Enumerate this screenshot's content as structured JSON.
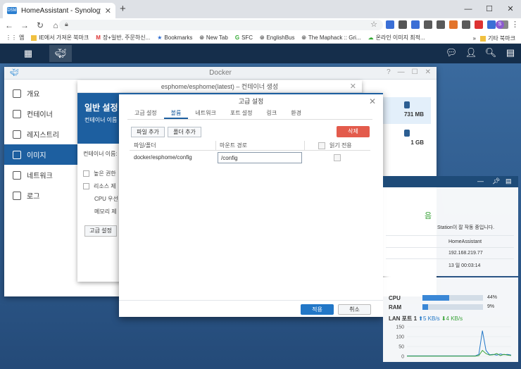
{
  "browser": {
    "tab_title": "HomeAssistant - Synology DiskS",
    "tab_favicon": "DSM",
    "url": "",
    "profile_initial": "S",
    "bookmarks": [
      "앱",
      "IE에서 가져온 북마크",
      "장+일반, 주문하신...",
      "Bookmarks",
      "New Tab",
      "SFC",
      "EnglishBus",
      "The Maphack :: Gri...",
      "온라인 이미지 최적..."
    ],
    "bookmarks_other": "기타 북마크",
    "more": "»"
  },
  "dsm": {
    "taskbar_icons": [
      "grid-icon",
      "docker-icon"
    ],
    "right_icons": [
      "chat-icon",
      "user-icon",
      "search-icon",
      "widget-icon"
    ]
  },
  "docker": {
    "title": "Docker",
    "sidebar": [
      {
        "label": "개요",
        "active": false
      },
      {
        "label": "컨테이너",
        "active": false
      },
      {
        "label": "레지스트리",
        "active": false
      },
      {
        "label": "이미지",
        "active": true
      },
      {
        "label": "네트워크",
        "active": false
      },
      {
        "label": "로그",
        "active": false
      }
    ],
    "image_sizes": [
      "731 MB",
      "1 GB"
    ]
  },
  "create": {
    "title": "esphome/esphome(latest) – 컨테이너 생성",
    "heading": "일반 설정",
    "subheading": "컨테이너 이름",
    "fields": [
      "컨테이너 이름:",
      "높은 권한",
      "리소스 제",
      "CPU 우선",
      "메모리 제"
    ],
    "advanced_button": "고급 설정"
  },
  "advanced": {
    "title": "고급 설정",
    "tabs": [
      "고급 설정",
      "볼륨",
      "네트워크",
      "포트 설정",
      "링크",
      "환경"
    ],
    "active_tab": 1,
    "add_file_button": "파일 추가",
    "add_folder_button": "폴더 추가",
    "delete_button": "삭제",
    "columns": [
      "파일/폴더",
      "마운트 경로",
      "읽기 전용"
    ],
    "rows": [
      {
        "source": "docker/esphome/config",
        "mount_path": "/config",
        "read_only": false
      }
    ],
    "apply_button": "적용",
    "cancel_button": "취소"
  },
  "health_widget": {
    "status": "음",
    "message": "Station이 잘 작동 중입니다.",
    "hostname": "HomeAssistant",
    "ip": "192.168.219.77",
    "uptime": "13 일 00:03:14"
  },
  "resource_widget": {
    "cpu_label": "CPU",
    "cpu_percent": 44,
    "cpu_text": "44%",
    "ram_label": "RAM",
    "ram_percent": 9,
    "ram_text": "9%",
    "lan_label": "LAN 포트 1",
    "lan_up": "5 KB/s",
    "lan_down": "4 KB/s",
    "colors": {
      "up": "#2277c7",
      "down": "#3aa33a"
    }
  },
  "chart_data": {
    "type": "line",
    "title": "",
    "ylim": [
      0,
      150
    ],
    "y_ticks": [
      "150",
      "100",
      "50",
      "0"
    ],
    "x": [
      0,
      1,
      2,
      3,
      4,
      5,
      6,
      7,
      8,
      9,
      10,
      11,
      12,
      13,
      14,
      15,
      16,
      17,
      18,
      19,
      20,
      21,
      22,
      23,
      24,
      25,
      26,
      27,
      28,
      29
    ],
    "series": [
      {
        "values": [
          2,
          2,
          2,
          2,
          2,
          2,
          2,
          2,
          2,
          2,
          2,
          2,
          2,
          2,
          2,
          2,
          2,
          2,
          2,
          2,
          10,
          130,
          30,
          8,
          10,
          6,
          12,
          8,
          10,
          6
        ]
      },
      {
        "values": [
          1,
          1,
          1,
          1,
          1,
          1,
          1,
          1,
          1,
          1,
          1,
          1,
          1,
          1,
          1,
          1,
          1,
          1,
          1,
          1,
          4,
          30,
          14,
          6,
          8,
          14,
          4,
          10,
          6,
          4
        ]
      }
    ]
  }
}
